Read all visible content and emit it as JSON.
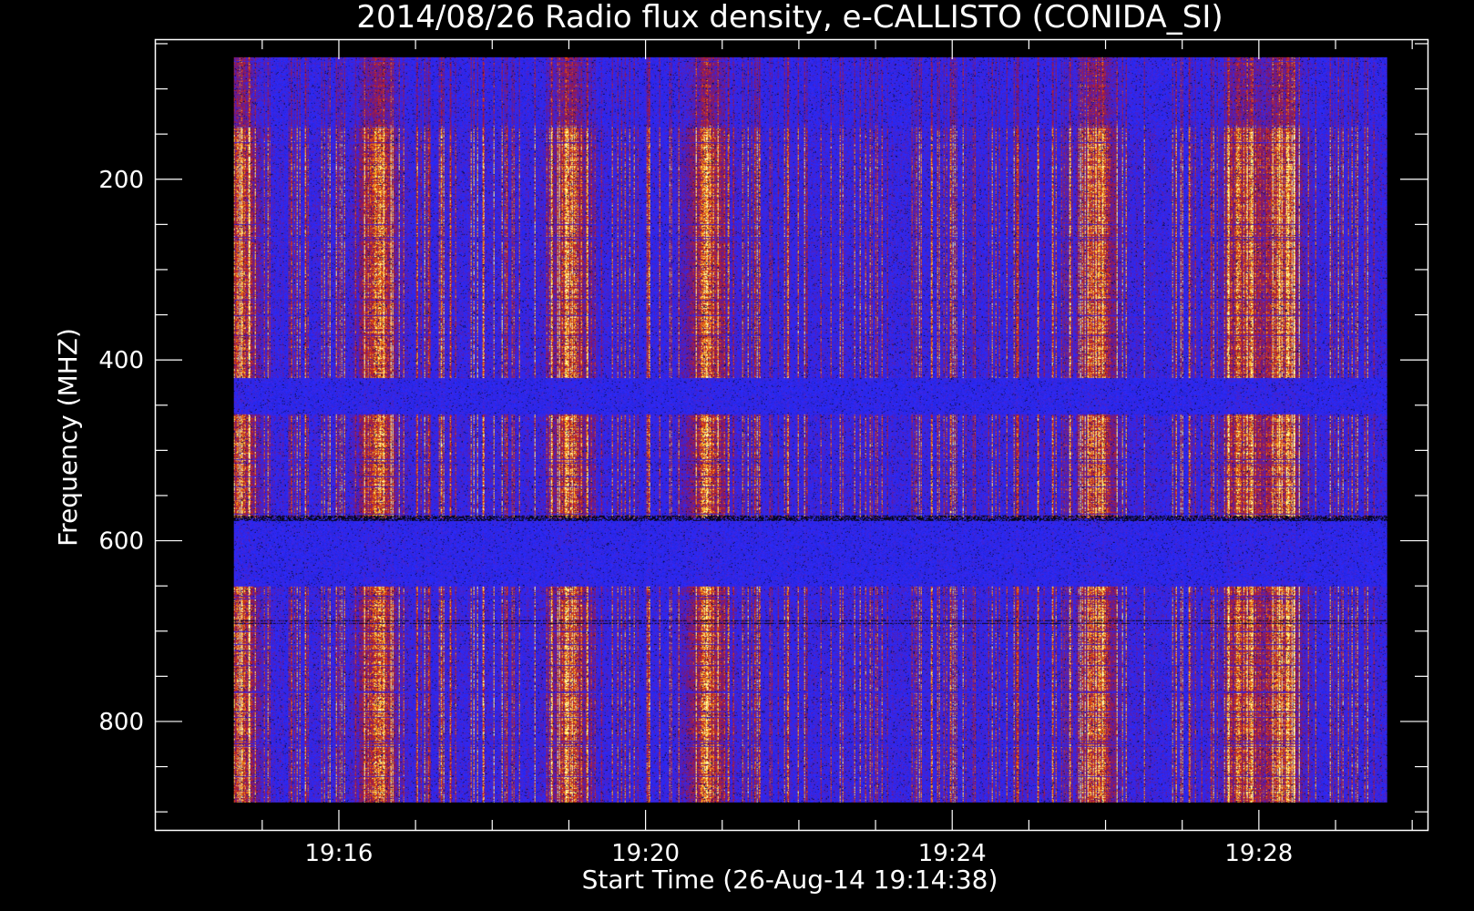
{
  "chart_data": {
    "type": "heatmap",
    "title": "2014/08/26  Radio flux density, e-CALLISTO (CONIDA_SI)",
    "xlabel": "Start Time (26-Aug-14 19:14:38)",
    "ylabel": "Frequency (MHZ)",
    "x_unit": "minutes of 19h UT",
    "xlim": [
      13.6,
      30.2
    ],
    "ylim": [
      920,
      45
    ],
    "data_xlim": [
      14.63,
      29.67
    ],
    "data_ylim": [
      65,
      890
    ],
    "x_major_ticks": [
      16,
      20,
      24,
      28
    ],
    "x_tick_labels": [
      "19:16",
      "19:20",
      "19:24",
      "19:28"
    ],
    "x_minor_step": 1,
    "y_major_ticks": [
      200,
      400,
      600,
      800
    ],
    "y_tick_labels": [
      "200",
      "400",
      "600",
      "800"
    ],
    "y_minor_step": 50,
    "colormap": [
      "#000000",
      "#1c1c9c",
      "#2a2aff",
      "#7a1570",
      "#d02a10",
      "#ffc020",
      "#ffffb0"
    ],
    "background_color": "#000000",
    "foreground_color": "#ffffff",
    "bright_bursts_minutes": [
      14.7,
      16.5,
      19.0,
      20.8,
      25.9,
      27.8,
      28.3
    ],
    "quiet_bands_mhz": [
      [
        575,
        650
      ],
      [
        420,
        460
      ]
    ]
  }
}
